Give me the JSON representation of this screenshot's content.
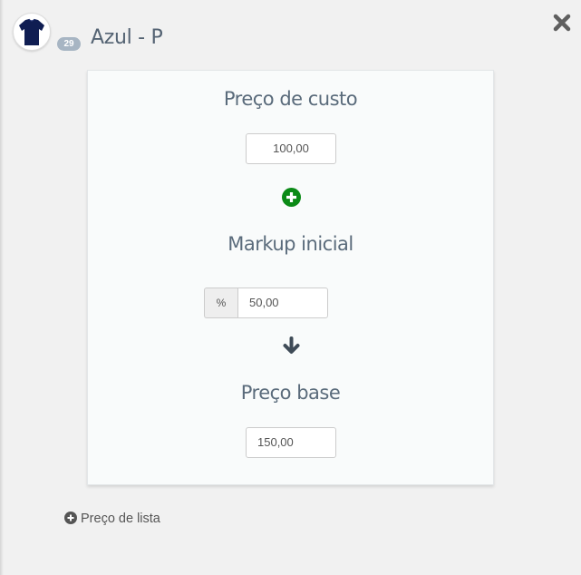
{
  "header": {
    "product_name": "Azul - P",
    "badge_count": "29",
    "avatar_icon": "tshirt-icon",
    "close_icon": "close-icon"
  },
  "pricing": {
    "cost": {
      "title": "Preço de custo",
      "value": "100,00"
    },
    "markup": {
      "title": "Markup inicial",
      "unit": "%",
      "value": "50,00"
    },
    "base": {
      "title": "Preço base",
      "value": "150,00"
    },
    "plus_icon": "plus-circle-icon",
    "arrow_icon": "arrow-down-icon"
  },
  "footer": {
    "add_list_price_label": "Preço de lista",
    "icon": "plus-circle-icon"
  },
  "colors": {
    "accent_green": "#0b8a16",
    "text_slate": "#546373",
    "badge": "#a7b5c3"
  }
}
